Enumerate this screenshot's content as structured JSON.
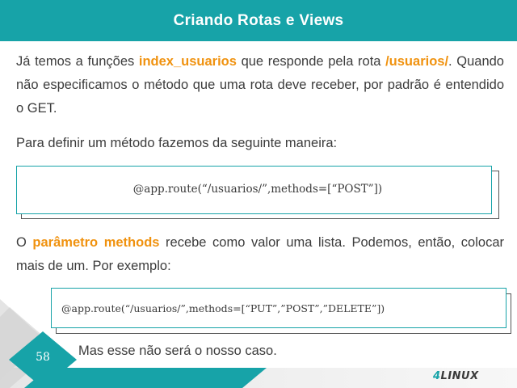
{
  "slide": {
    "title": "Criando Rotas e Views",
    "page_number": "58"
  },
  "content": {
    "p1": {
      "t1": "Já temos a funções ",
      "h1": "index_usuarios",
      "t2": " que responde pela rota ",
      "h2": "/usuarios/",
      "t3": ". Quando não especificamos o método que uma rota deve receber, por padrão é entendido o GET."
    },
    "p2": "Para definir um método fazemos da seguinte maneira:",
    "code1": "@app.route(“/usuarios/”,methods=[“POST”])",
    "p3": {
      "t1": "O ",
      "h1": "parâmetro methods",
      "t2": " recebe como valor uma lista. Podemos, então, colocar mais de um. Por exemplo:"
    },
    "code2": "@app.route(“/usuarios/”,methods=[“PUT”,”POST”,”DELETE”])",
    "p4": "Mas esse não será o nosso caso."
  },
  "logo": {
    "prefix": "4",
    "text": "LINUX"
  },
  "colors": {
    "accent": "#17a3a8",
    "highlight": "#f0920f",
    "text": "#3c3c3c"
  }
}
